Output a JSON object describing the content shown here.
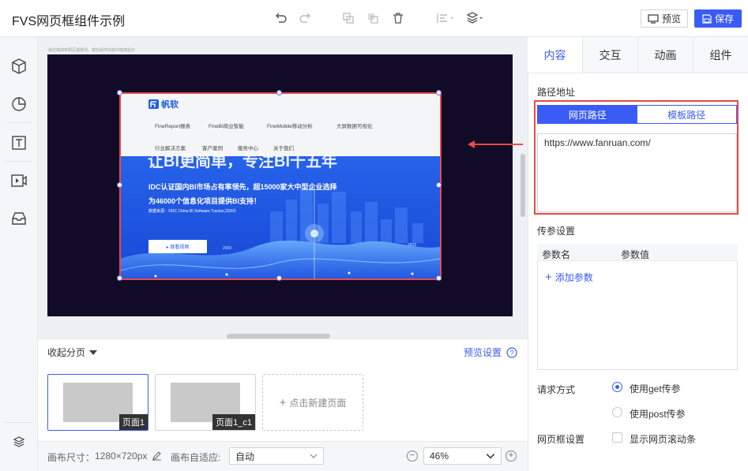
{
  "app": {
    "title": "FVS网页框组件示例"
  },
  "toolbar": {
    "preview_label": "预览",
    "save_label": "保存"
  },
  "canvas": {
    "note": "通过拖动布局区域排列，或在组件内容中拖拽显示"
  },
  "webframe": {
    "logo": "帆软",
    "nav_row1": [
      "FineReport报表",
      "FineBI商业智能",
      "FineMobile移动分析",
      "大屏数据可视化"
    ],
    "nav_row2": [
      "行业解决方案",
      "客户案例",
      "服务中心",
      "关于我们"
    ],
    "hero": "让BI更简单，专注BI十五年",
    "line1": "IDC认证国内BI市场占有率领先，超15000家大中型企业选择",
    "line2": "为46000个信息化项目提供BI支持！",
    "small": "数据来源：《IDC China BI Software Tracker,2020》",
    "button": "▸ 观看视频",
    "stat_left": "2600",
    "stat_right": "2815"
  },
  "pages": {
    "collapse_label": "收起分页",
    "preview_settings": "预览设置",
    "items": [
      {
        "label": "页面1"
      },
      {
        "label": "页面1_c1"
      }
    ],
    "new_page": "点击新建页面"
  },
  "statusbar": {
    "canvas_size_label": "画布尺寸：",
    "canvas_size": "1280×720px",
    "adapt_label": "画布自适应:",
    "adapt_value": "自动",
    "zoom": "46%"
  },
  "panel": {
    "tabs": [
      "内容",
      "交互",
      "动画",
      "组件"
    ],
    "path_label": "路径地址",
    "seg_web": "网页路径",
    "seg_template": "模板路径",
    "url": "https://www.fanruan.com/",
    "param_label": "传参设置",
    "param_col1": "参数名",
    "param_col2": "参数值",
    "add_param": "添加参数",
    "request_label": "请求方式",
    "opt_get": "使用get传参",
    "opt_post": "使用post传参",
    "frame_label": "网页框设置",
    "scroll_opt": "显示网页滚动条"
  },
  "colors": {
    "accent": "#3a5cf5",
    "highlight": "#e74a4a",
    "stage": "#110b28"
  }
}
